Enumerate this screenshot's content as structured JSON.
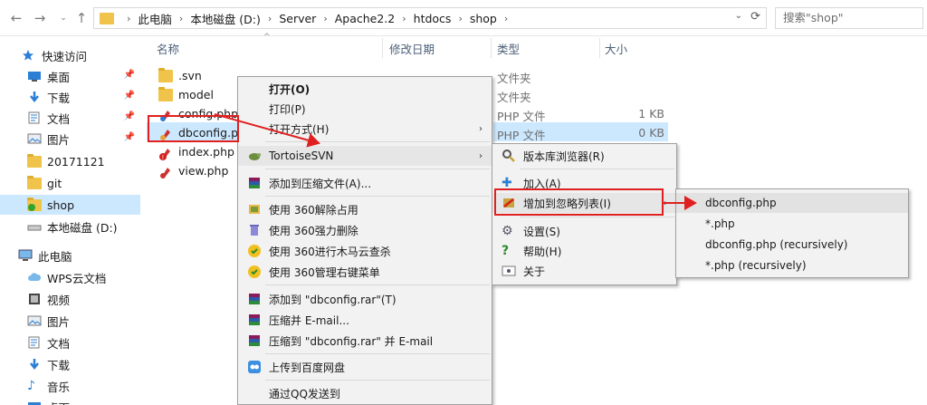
{
  "address": {
    "segments": [
      "此电脑",
      "本地磁盘 (D:)",
      "Server",
      "Apache2.2",
      "htdocs",
      "shop"
    ],
    "search_placeholder": "搜索\"shop\""
  },
  "nav": {
    "items": [
      {
        "label": "快速访问",
        "icon": "star-icon"
      },
      {
        "label": "桌面",
        "icon": "desktop-icon",
        "pinned": true
      },
      {
        "label": "下载",
        "icon": "download-icon",
        "pinned": true
      },
      {
        "label": "文档",
        "icon": "document-icon",
        "pinned": true
      },
      {
        "label": "图片",
        "icon": "picture-icon",
        "pinned": true
      },
      {
        "label": "20171121",
        "icon": "folder-icon"
      },
      {
        "label": "git",
        "icon": "folder-icon"
      },
      {
        "label": "shop",
        "icon": "svn-folder-icon",
        "selected": true
      },
      {
        "label": "本地磁盘 (D:)",
        "icon": "drive-icon"
      },
      {
        "label": "此电脑",
        "icon": "computer-icon"
      },
      {
        "label": "WPS云文档",
        "icon": "cloud-icon"
      },
      {
        "label": "视频",
        "icon": "video-icon"
      },
      {
        "label": "图片",
        "icon": "picture-icon"
      },
      {
        "label": "文档",
        "icon": "document-icon"
      },
      {
        "label": "下载",
        "icon": "download-icon"
      },
      {
        "label": "音乐",
        "icon": "music-icon"
      },
      {
        "label": "桌面",
        "icon": "desktop-icon"
      }
    ]
  },
  "columns": {
    "name": "名称",
    "modified": "修改日期",
    "type": "类型",
    "size": "大小"
  },
  "files": [
    {
      "name": ".svn",
      "type": "文件夹",
      "size": "",
      "icon": "folder-icon"
    },
    {
      "name": "model",
      "type": "文件夹",
      "size": "",
      "icon": "folder-icon"
    },
    {
      "name": "config.php",
      "type": "PHP 文件",
      "size": "1 KB",
      "icon": "php-file-icon"
    },
    {
      "name": "dbconfig.php",
      "type": "PHP 文件",
      "size": "0 KB",
      "icon": "php-file-icon",
      "selected": true
    },
    {
      "name": "index.php",
      "type": "",
      "size": "",
      "icon": "php-conflict-icon"
    },
    {
      "name": "view.php",
      "type": "",
      "size": "",
      "icon": "php-file-icon"
    }
  ],
  "context_menu": {
    "items": [
      {
        "label": "打开(O)",
        "bold": true
      },
      {
        "label": "打印(P)"
      },
      {
        "label": "打开方式(H)",
        "submenu": true
      },
      {
        "label": "TortoiseSVN",
        "submenu": true,
        "icon": "tortoise-icon"
      },
      {
        "label": "添加到压缩文件(A)...",
        "icon": "winrar-icon"
      },
      {
        "label": "使用 360解除占用",
        "icon": "unlock-360-icon"
      },
      {
        "label": "使用 360强力删除",
        "icon": "delete-360-icon"
      },
      {
        "label": "使用 360进行木马云查杀",
        "icon": "scan-360-icon"
      },
      {
        "label": "使用 360管理右键菜单",
        "icon": "menu-360-icon"
      },
      {
        "label": "添加到 \"dbconfig.rar\"(T)",
        "icon": "winrar-icon"
      },
      {
        "label": "压缩并 E-mail...",
        "icon": "winrar-icon"
      },
      {
        "label": "压缩到 \"dbconfig.rar\" 并 E-mail",
        "icon": "winrar-icon"
      },
      {
        "label": "上传到百度网盘",
        "icon": "baidu-icon"
      },
      {
        "label": "通过QQ发送到"
      }
    ]
  },
  "svn_menu": {
    "items": [
      {
        "label": "版本库浏览器(R)",
        "icon": "repo-browser-icon"
      },
      {
        "label": "加入(A)",
        "icon": "add-icon"
      },
      {
        "label": "增加到忽略列表(I)",
        "icon": "ignore-icon",
        "submenu": true
      },
      {
        "label": "设置(S)",
        "icon": "settings-icon"
      },
      {
        "label": "帮助(H)",
        "icon": "help-icon"
      },
      {
        "label": "关于",
        "icon": "about-icon"
      }
    ]
  },
  "ignore_menu": {
    "items": [
      {
        "label": "dbconfig.php"
      },
      {
        "label": "*.php"
      },
      {
        "label": "dbconfig.php (recursively)"
      },
      {
        "label": "*.php (recursively)"
      }
    ]
  },
  "colors": {
    "accent": "#cce8ff",
    "callout": "#e02020",
    "folder": "#f0c34a"
  }
}
